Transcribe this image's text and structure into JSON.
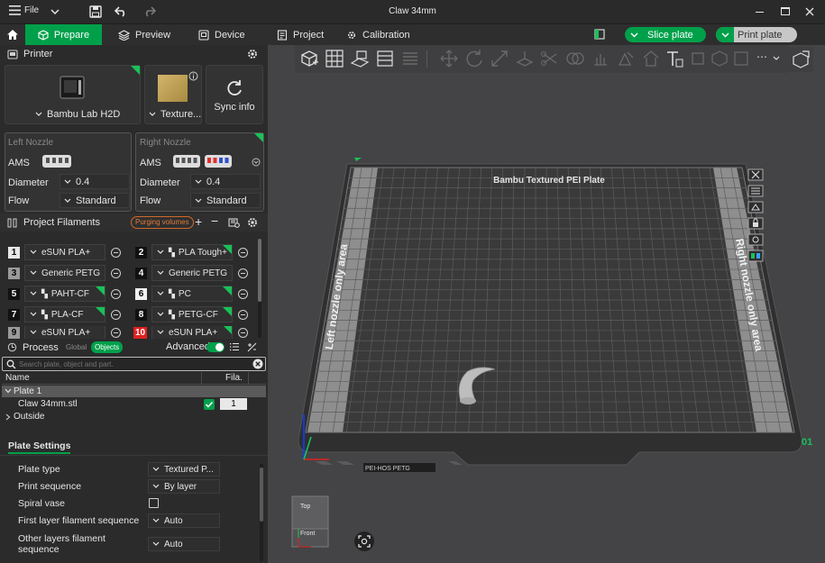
{
  "window": {
    "title": "Claw 34mm",
    "file_menu": "File"
  },
  "tabs": [
    {
      "label": "Prepare"
    },
    {
      "label": "Preview"
    },
    {
      "label": "Device"
    },
    {
      "label": "Project"
    },
    {
      "label": "Calibration"
    }
  ],
  "actions": {
    "slice": "Slice plate",
    "print": "Print plate"
  },
  "printer": {
    "section": "Printer",
    "name": "Bambu Lab H2D",
    "plate": "Texture...",
    "sync": "Sync info"
  },
  "nozzles": {
    "left": {
      "title": "Left Nozzle",
      "ams": "AMS",
      "diameter_label": "Diameter",
      "diameter": "0.4",
      "flow_label": "Flow",
      "flow": "Standard"
    },
    "right": {
      "title": "Right Nozzle",
      "ams": "AMS",
      "diameter_label": "Diameter",
      "diameter": "0.4",
      "flow_label": "Flow",
      "flow": "Standard"
    }
  },
  "filaments": {
    "section": "Project Filaments",
    "purging": "Purging volumes",
    "items": [
      {
        "num": "1",
        "name": "eSUN PLA+",
        "color": "#e8e8e8"
      },
      {
        "num": "2",
        "name": "PLA Tough+",
        "color": "#111111"
      },
      {
        "num": "3",
        "name": "Generic PETG",
        "color": "#9a9a9a"
      },
      {
        "num": "4",
        "name": "Generic PETG",
        "color": "#111111"
      },
      {
        "num": "5",
        "name": "PAHT-CF",
        "color": "#111111"
      },
      {
        "num": "6",
        "name": "PC",
        "color": "#f2f2f2"
      },
      {
        "num": "7",
        "name": "PLA-CF",
        "color": "#111111"
      },
      {
        "num": "8",
        "name": "PETG-CF",
        "color": "#111111"
      },
      {
        "num": "9",
        "name": "eSUN PLA+",
        "color": "#9a9a9a"
      },
      {
        "num": "10",
        "name": "eSUN PLA+",
        "color": "#e02020"
      }
    ]
  },
  "process": {
    "section": "Process",
    "global": "Global",
    "objects": "Objects",
    "advanced": "Advanced"
  },
  "search": {
    "placeholder": "Search plate, object and part."
  },
  "objects": {
    "col_name": "Name",
    "col_fila": "Fila.",
    "plate": "Plate 1",
    "object": "Claw 34mm.stl",
    "object_fila": "1",
    "outside": "Outside"
  },
  "plate_settings": {
    "title": "Plate Settings",
    "rows": [
      {
        "label": "Plate type",
        "value": "Textured P..."
      },
      {
        "label": "Print sequence",
        "value": "By layer"
      },
      {
        "label": "Spiral vase",
        "value": ""
      },
      {
        "label": "First layer filament sequence",
        "value": "Auto"
      },
      {
        "label": "Other layers filament sequence",
        "value": "Auto"
      }
    ]
  },
  "bed": {
    "plate_name": "Bambu Textured PEI Plate",
    "left_area": "Left nozzle only area",
    "right_area": "Right nozzle only area",
    "plate_number": "01",
    "front_label": "PEI-HOS PETG"
  },
  "viewcube": {
    "top": "Top",
    "front": "Front"
  },
  "colors": {
    "accent": "#00a04a",
    "grid": "#6b6b6b",
    "bed": "#3a3a3a"
  }
}
